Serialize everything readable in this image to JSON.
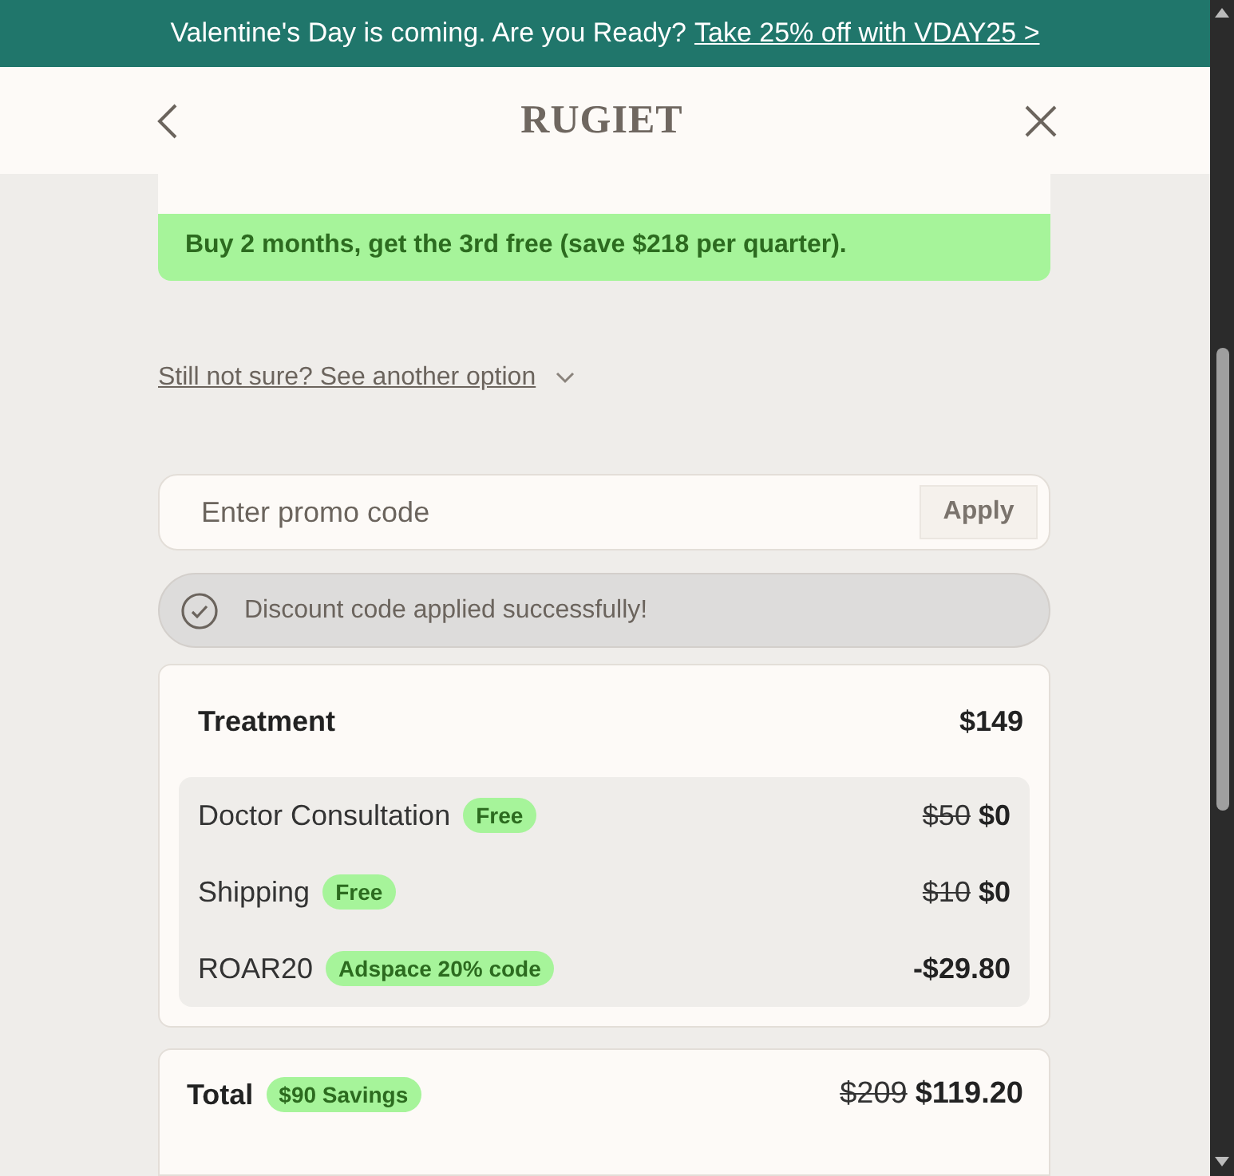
{
  "banner": {
    "text": "Valentine's Day is coming. Are you Ready?",
    "link": "Take 25% off with VDAY25 >"
  },
  "header": {
    "title": "RUGIET"
  },
  "offer": {
    "text": "Buy 2 months, get the 3rd free (save $218 per quarter)."
  },
  "another_option": {
    "label": "Still not sure? See another option",
    "expanded": false
  },
  "promo": {
    "placeholder": "Enter promo code",
    "button": "Apply"
  },
  "success": {
    "message": "Discount code applied successfully!"
  },
  "order": {
    "label": "Treatment",
    "price": "$149",
    "items": [
      {
        "name": "Doctor Consultation",
        "badge": "Free",
        "old_price": "$50",
        "price": "$0"
      },
      {
        "name": "Shipping",
        "badge": "Free",
        "old_price": "$10",
        "price": "$0"
      },
      {
        "name": "ROAR20",
        "badge": "Adspace 20% code",
        "price": "-$29.80"
      }
    ]
  },
  "total": {
    "label": "Total",
    "badge": "$90 Savings",
    "old_price": "$209",
    "price": "$119.20"
  }
}
